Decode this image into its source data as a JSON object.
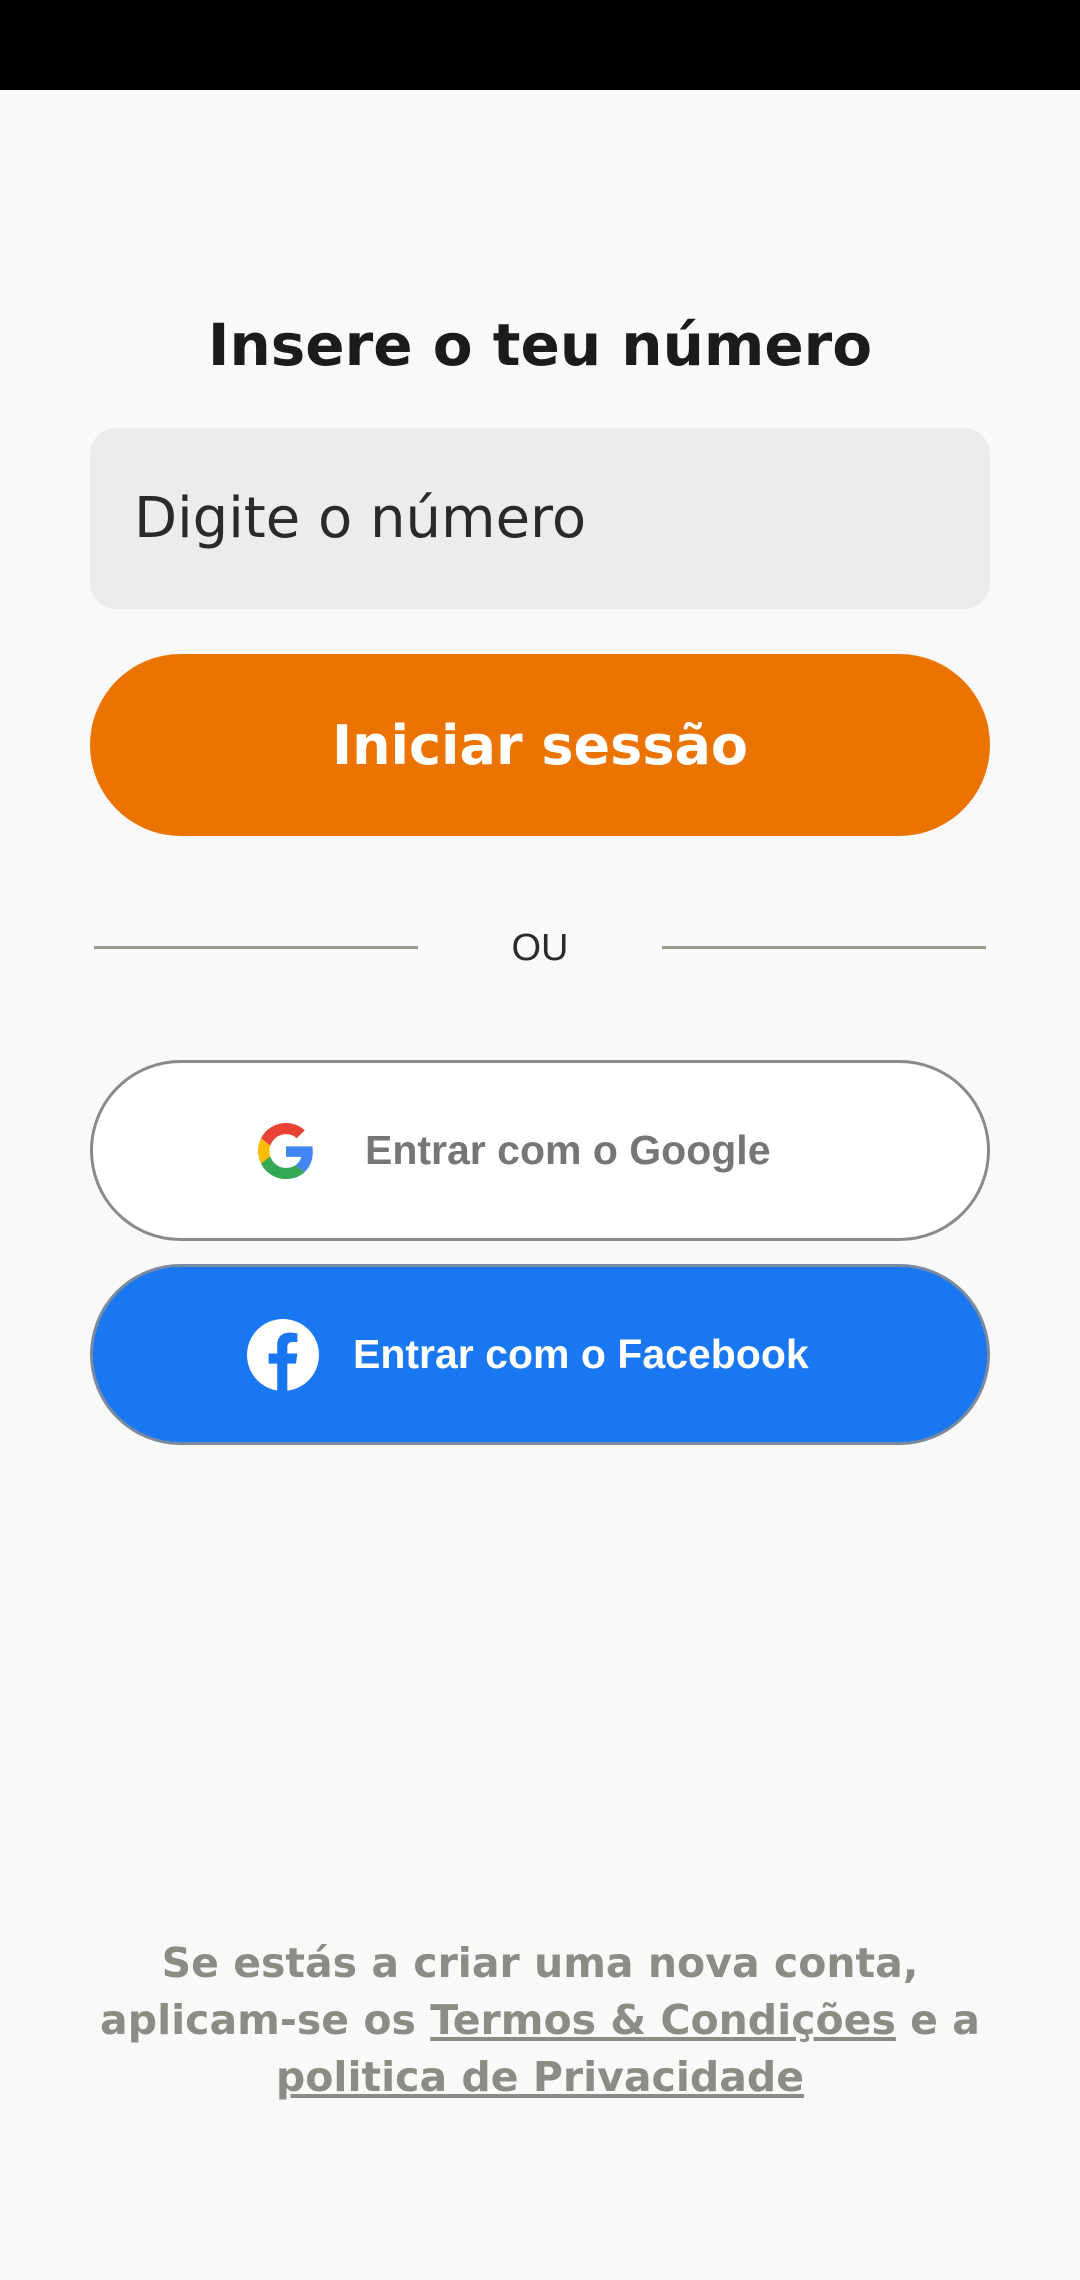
{
  "colors": {
    "background": "#f9f9f9",
    "status_bar": "#000000",
    "accent": "#eb7300",
    "facebook": "#1a77f2",
    "input_bg": "#ececec",
    "muted_text": "#8c8c86"
  },
  "login": {
    "title": "Insere o teu número",
    "phone_placeholder": "Digite o número",
    "submit_label": "Iniciar sessão",
    "divider_label": "OU"
  },
  "social": {
    "google": {
      "label": "Entrar com o Google",
      "icon": "google-logo-icon"
    },
    "facebook": {
      "label": "Entrar com o Facebook",
      "icon": "facebook-logo-icon"
    }
  },
  "footer": {
    "text_before": "Se estás a criar uma nova conta, aplicam-se os ",
    "terms_link": "Termos & Condições",
    "text_middle": " e a ",
    "privacy_link": "politica de Privacidade"
  }
}
